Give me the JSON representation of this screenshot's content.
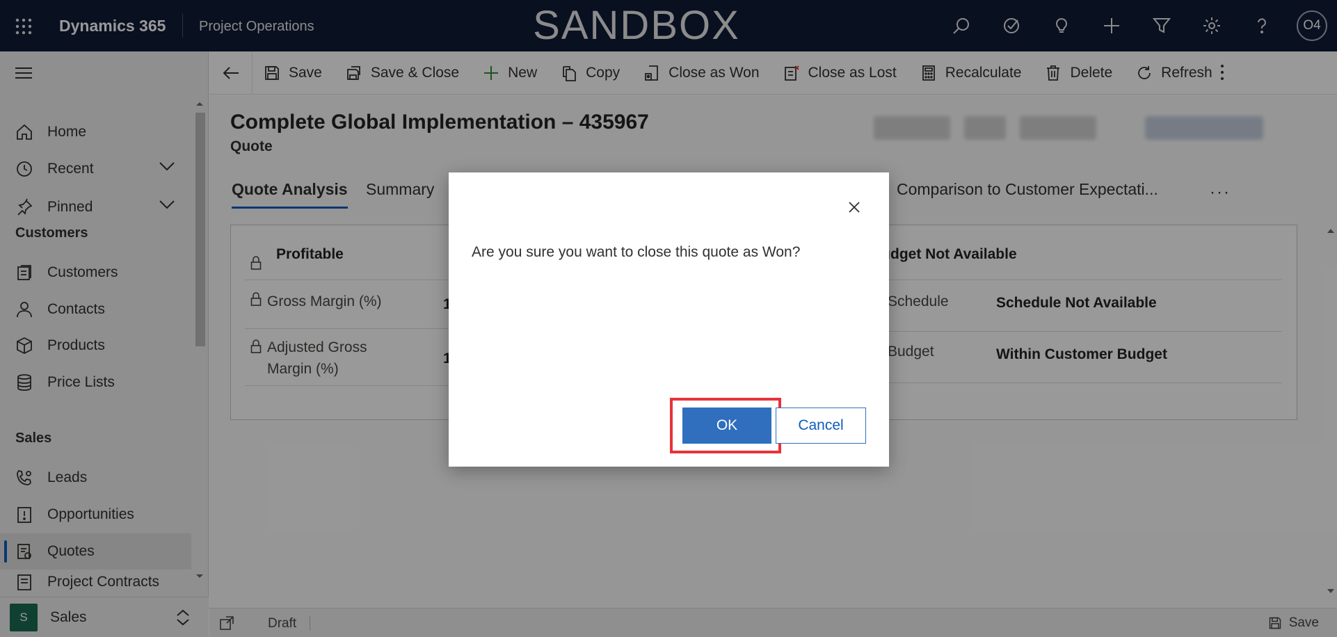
{
  "topbar": {
    "brand": "Dynamics 365",
    "app_name": "Project Operations",
    "environment": "SANDBOX",
    "icons": [
      "search-icon",
      "task-icon",
      "lightbulb-icon",
      "plus-icon",
      "filter-icon",
      "gear-icon",
      "help-icon"
    ],
    "avatar_initials": "O4",
    "background": "#0f1b36"
  },
  "sidebar": {
    "items": [
      {
        "label": "Home",
        "icon": "home-icon"
      },
      {
        "label": "Recent",
        "icon": "clock-icon"
      },
      {
        "label": "Pinned",
        "icon": "pin-icon"
      }
    ],
    "groups": [
      {
        "title": "Customers",
        "items": [
          {
            "label": "Customers",
            "icon": "customers-icon"
          },
          {
            "label": "Contacts",
            "icon": "person-icon"
          },
          {
            "label": "Products",
            "icon": "box-icon"
          },
          {
            "label": "Price Lists",
            "icon": "database-icon"
          }
        ]
      },
      {
        "title": "Sales",
        "items": [
          {
            "label": "Leads",
            "icon": "phone-person-icon"
          },
          {
            "label": "Opportunities",
            "icon": "opportunity-icon"
          },
          {
            "label": "Quotes",
            "icon": "quote-icon",
            "selected": true
          },
          {
            "label": "Project Contracts",
            "icon": "contract-icon"
          }
        ]
      }
    ],
    "area": {
      "badge": "S",
      "name": "Sales",
      "badge_color": "#1c6b52"
    }
  },
  "commandbar": {
    "items": [
      {
        "label": "Save",
        "icon": "save-icon"
      },
      {
        "label": "Save & Close",
        "icon": "save-close-icon"
      },
      {
        "label": "New",
        "icon": "plus-icon"
      },
      {
        "label": "Copy",
        "icon": "copy-icon"
      },
      {
        "label": "Close as Won",
        "icon": "close-won-icon"
      },
      {
        "label": "Close as Lost",
        "icon": "close-lost-icon"
      },
      {
        "label": "Recalculate",
        "icon": "calculator-icon"
      },
      {
        "label": "Delete",
        "icon": "trash-icon"
      },
      {
        "label": "Refresh",
        "icon": "refresh-icon"
      }
    ]
  },
  "record": {
    "title": "Complete Global Implementation – 435967",
    "type": "Quote"
  },
  "tabs": {
    "active": "Quote Analysis",
    "summary": "Summary",
    "comparison": "Comparison to Customer Expectati...",
    "more": "···"
  },
  "card": {
    "left_section": "Profitable",
    "gross_margin_label": "Gross Margin (%)",
    "adjusted_margin_label_1": "Adjusted Gross",
    "adjusted_margin_label_2": "Margin (%)",
    "gross_margin_value": "1",
    "adjusted_margin_value": "1",
    "right_section": "r Budget Not Available",
    "schedule_label": "Schedule",
    "schedule_value": "Schedule Not Available",
    "budget_label": "Budget",
    "budget_value": "Within Customer Budget"
  },
  "statusbar": {
    "status": "Draft",
    "save_label": "Save"
  },
  "dialog": {
    "message": "Are you sure you want to close this quote as Won?",
    "ok_label": "OK",
    "cancel_label": "Cancel",
    "ok_color": "#2f6fbd",
    "highlight_color": "#e8323a"
  }
}
